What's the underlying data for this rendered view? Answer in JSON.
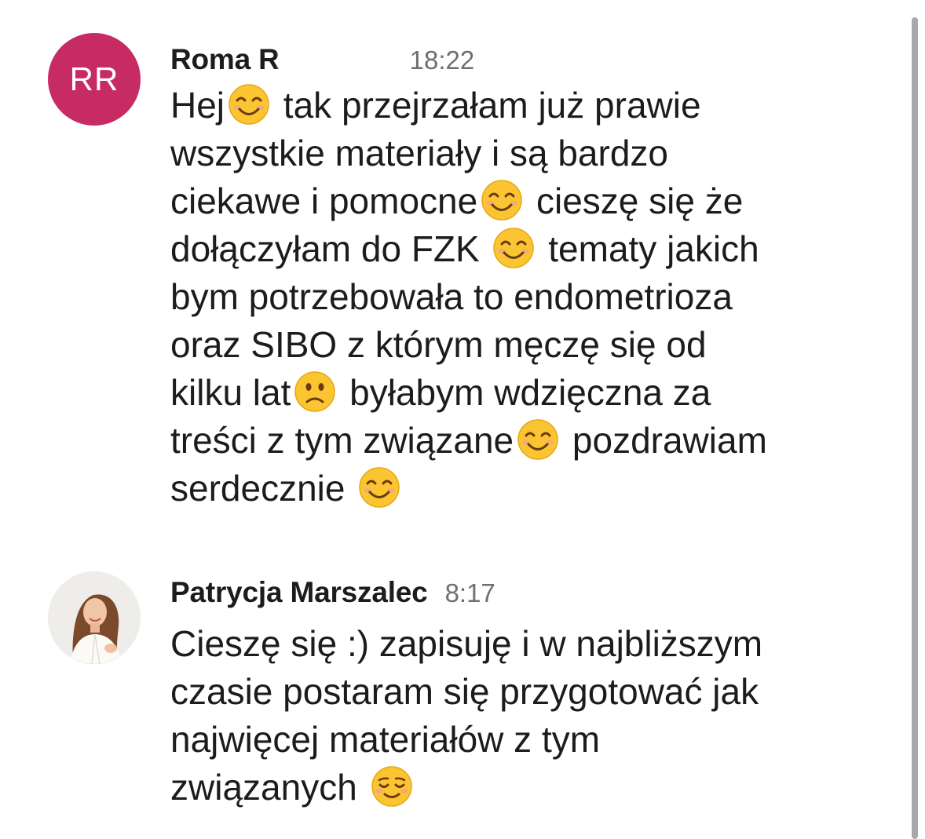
{
  "messages": [
    {
      "avatar_initials": "RR",
      "sender": "Roma R",
      "time": "18:22",
      "lines": [
        [
          "Hej",
          "smile",
          " tak przejrzałam już prawie"
        ],
        [
          "wszystkie materiały i są bardzo"
        ],
        [
          "ciekawe i pomocne",
          "smile",
          " cieszę się że"
        ],
        [
          "dołączyłam do FZK ",
          "smile",
          " tematy jakich"
        ],
        [
          "bym potrzebowała to endometrioza"
        ],
        [
          "oraz SIBO z którym męczę się od"
        ],
        [
          "kilku lat",
          "frown",
          " byłabym wdzięczna za"
        ],
        [
          "treści z tym związane",
          "smile",
          " pozdrawiam"
        ],
        [
          "serdecznie ",
          "smile"
        ]
      ]
    },
    {
      "avatar_icon": "profile-photo",
      "sender": "Patrycja Marszalec",
      "time": "8:17",
      "lines": [
        [
          "Cieszę się :) zapisuję i w najbliższym"
        ],
        [
          "czasie postaram się przygotować jak"
        ],
        [
          "najwięcej materiałów z tym"
        ],
        [
          "związanych ",
          "relieved"
        ]
      ]
    }
  ],
  "colors": {
    "avatar_bg": "#c62b63",
    "time": "#6e6e73",
    "emoji_face": "#fbc531",
    "text": "#1c1c1e"
  }
}
